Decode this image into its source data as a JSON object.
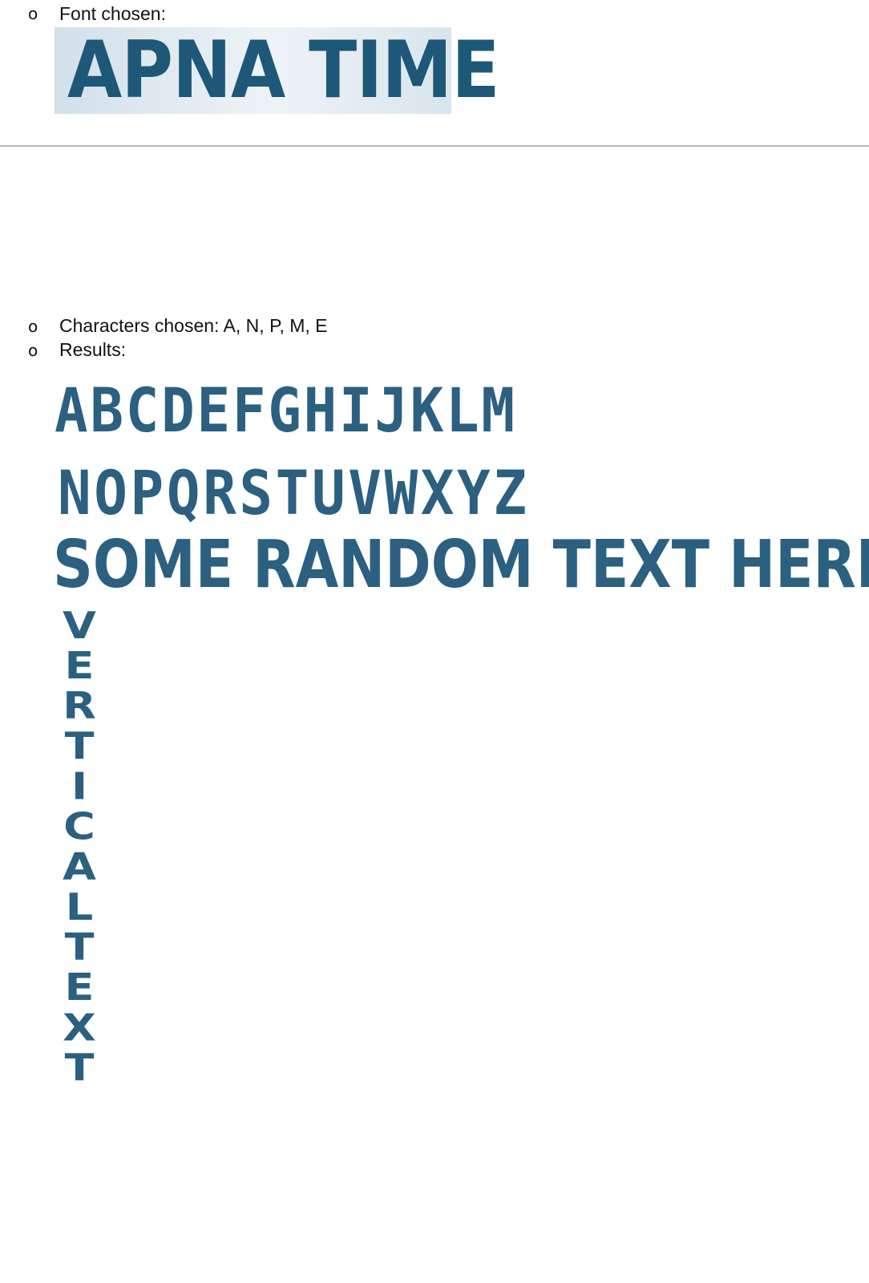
{
  "font_section": {
    "label": "Font chosen:",
    "sample_text": "APNA TIME",
    "bullet": "o"
  },
  "characters": {
    "label": "Characters chosen: A, N, P, M, E",
    "bullet": "o"
  },
  "results": {
    "label": "Results:",
    "bullet": "o",
    "alphabet_row_1": "ABCDEFGHIJKLM",
    "alphabet_row_2": "NOPQRSTUVWXYZ",
    "random_text": "SOME RANDOM TEXT HERE",
    "vertical_text": "VERTICAL TEXT"
  },
  "colors": {
    "glyph": "#2b6080",
    "sample_background": "#dde8ef",
    "divider": "#b8b8b8"
  }
}
